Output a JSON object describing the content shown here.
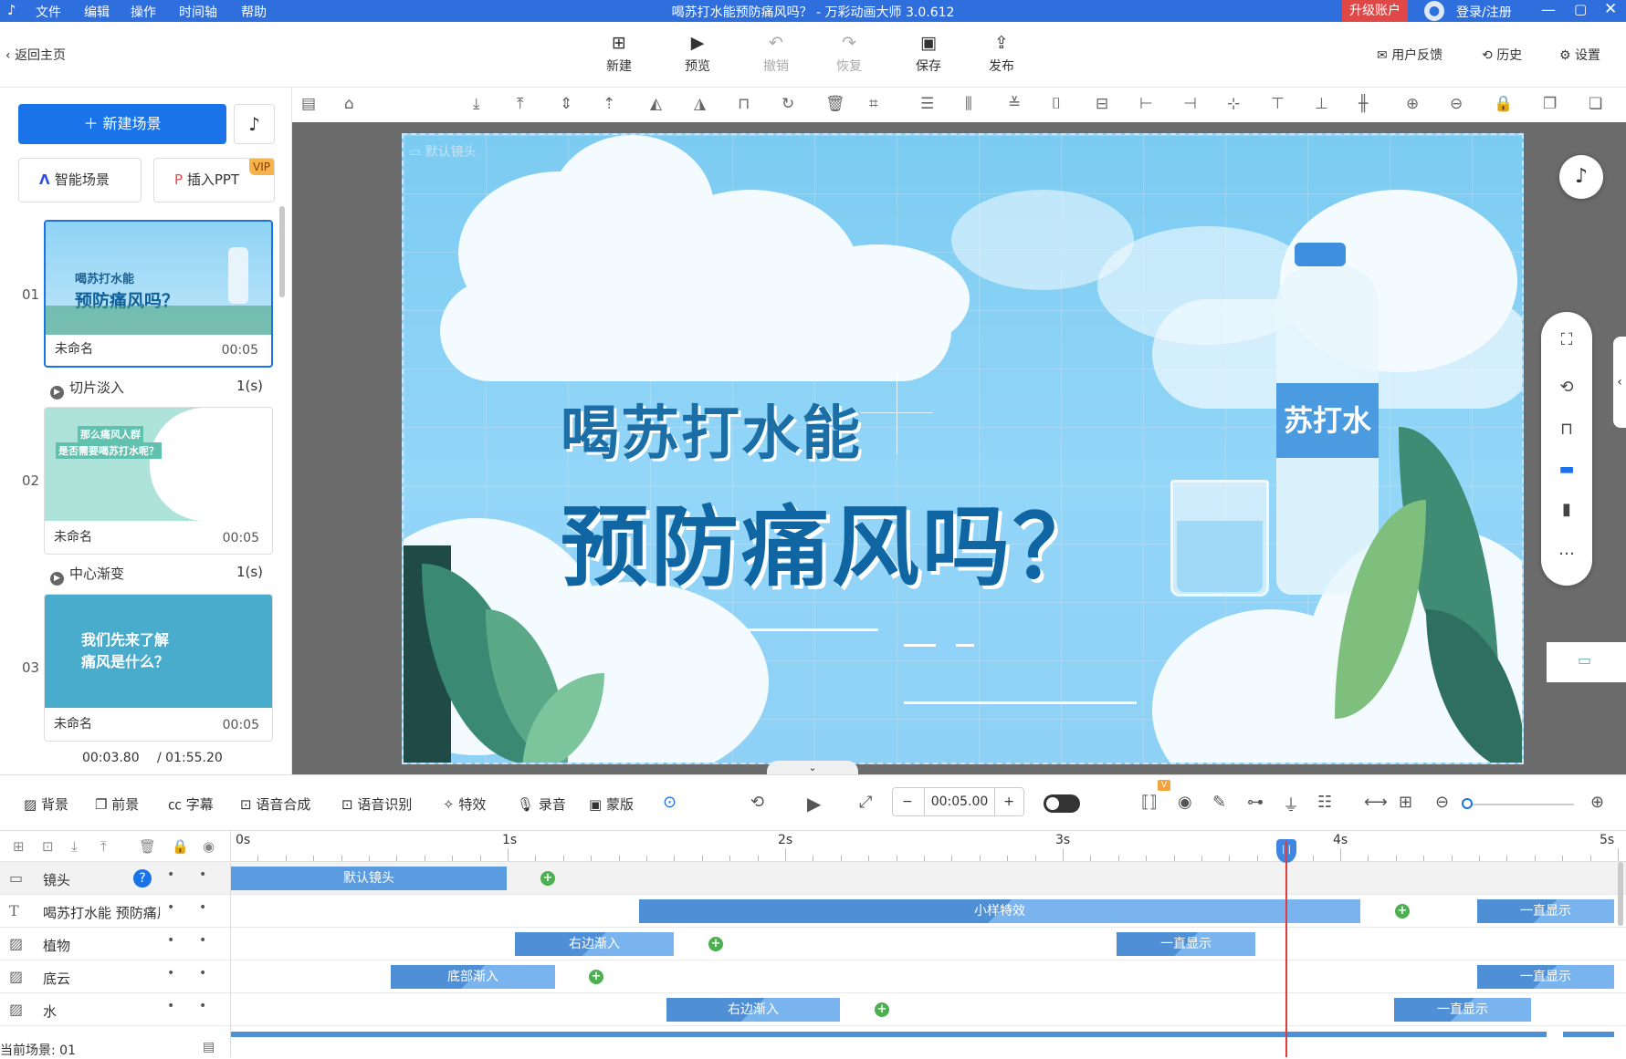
{
  "window": {
    "title": "喝苏打水能预防痛风吗？ - 万彩动画大师 3.0.612",
    "menus": [
      "文件",
      "编辑",
      "操作",
      "时间轴",
      "帮助"
    ],
    "upgrade": "升级账户",
    "login": "登录/注册"
  },
  "topbar": {
    "back": "返回主页",
    "buttons": [
      {
        "label": "新建",
        "icon": "plus-square-icon"
      },
      {
        "label": "预览",
        "icon": "play-icon"
      },
      {
        "label": "撤销",
        "icon": "undo-icon"
      },
      {
        "label": "恢复",
        "icon": "redo-icon"
      },
      {
        "label": "保存",
        "icon": "save-icon"
      },
      {
        "label": "发布",
        "icon": "publish-icon"
      }
    ],
    "right": [
      {
        "label": "用户反馈",
        "icon": "feedback-icon"
      },
      {
        "label": "历史",
        "icon": "history-icon"
      },
      {
        "label": "设置",
        "icon": "gear-icon"
      }
    ]
  },
  "left": {
    "new_scene": "新建场景",
    "smart_scene": "智能场景",
    "insert_ppt": "插入PPT",
    "vip": "VIP",
    "scenes": [
      {
        "num": "01",
        "name": "未命名",
        "duration": "00:05",
        "thumb_line1": "喝苏打水能",
        "thumb_line2": "预防痛风吗？"
      },
      {
        "num": "02",
        "name": "未命名",
        "duration": "00:05",
        "thumb_line1": "那么痛风人群",
        "thumb_line2": "是否需要喝苏打水呢？"
      },
      {
        "num": "03",
        "name": "未命名",
        "duration": "00:05",
        "thumb_line1": "我们先来了解",
        "thumb_line2": "痛风是什么？"
      }
    ],
    "transitions": [
      {
        "name": "切片淡入",
        "duration": "1(s)"
      },
      {
        "name": "中心渐变",
        "duration": "1(s)"
      }
    ],
    "current_time": "00:03.80",
    "total_time": "/ 01:55.20"
  },
  "canvas": {
    "camera_label": "默认镜头",
    "line1": "喝苏打水能",
    "line2": "预防痛风吗？",
    "bottle_label": "苏打水"
  },
  "timeline_toolbar": {
    "items": [
      "背景",
      "前景",
      "字幕",
      "语音合成",
      "语音识别",
      "特效",
      "录音",
      "蒙版"
    ],
    "time_value": "00:05.00",
    "minus": "−",
    "plus": "+"
  },
  "ruler": [
    "0s",
    "1s",
    "2s",
    "3s",
    "4s",
    "5s"
  ],
  "tracks": [
    {
      "name": "镜头",
      "icon": "camera-icon",
      "segments": [
        {
          "label": "默认镜头"
        }
      ]
    },
    {
      "name": "喝苏打水能 预防痛风吗？",
      "icon": "text-icon",
      "segments": [
        {
          "label": "小样特效"
        },
        {
          "label": "一直显示"
        }
      ]
    },
    {
      "name": "植物",
      "icon": "image-icon",
      "segments": [
        {
          "label": "右边渐入"
        },
        {
          "label": "一直显示"
        }
      ]
    },
    {
      "name": "底云",
      "icon": "image-icon",
      "segments": [
        {
          "label": "底部渐入"
        },
        {
          "label": "一直显示"
        }
      ]
    },
    {
      "name": "水",
      "icon": "image-icon",
      "segments": [
        {
          "label": "右边渐入"
        },
        {
          "label": "一直显示"
        }
      ]
    }
  ],
  "status": {
    "current_scene": "当前场景: 01"
  }
}
